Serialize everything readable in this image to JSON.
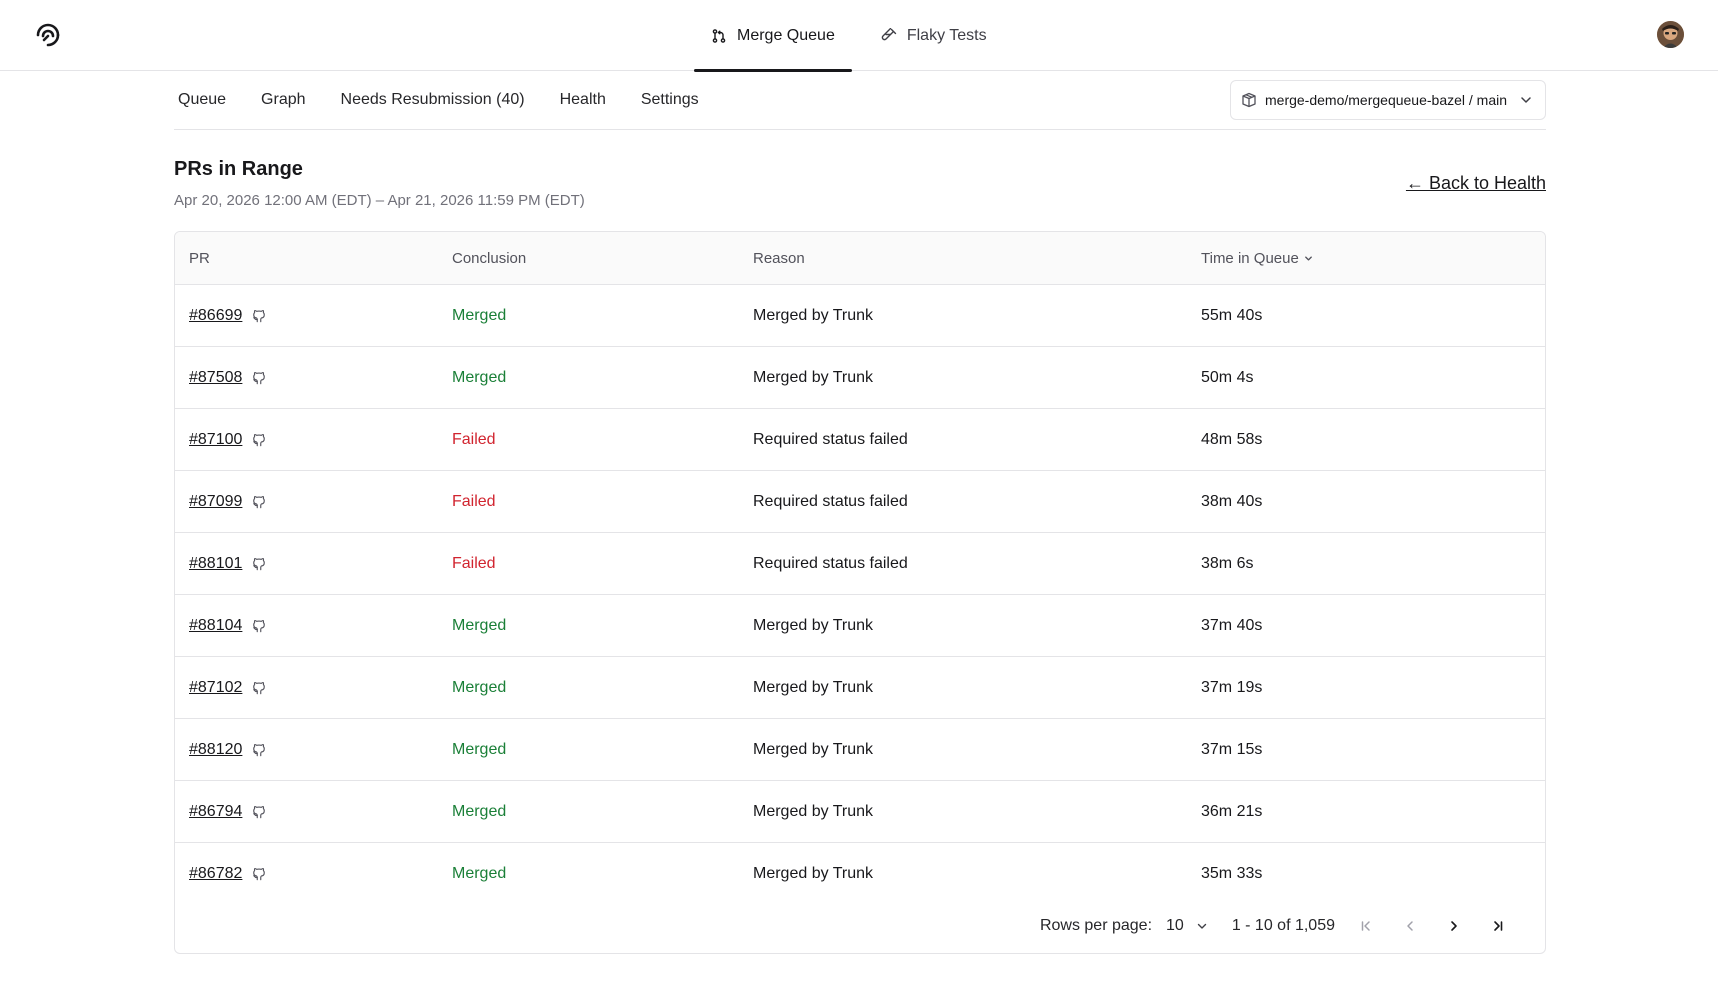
{
  "topnav": {
    "tabs": [
      {
        "label": "Merge Queue",
        "icon": "merge-icon",
        "active": true
      },
      {
        "label": "Flaky Tests",
        "icon": "test-tube-icon",
        "active": false
      }
    ]
  },
  "subnav": {
    "tabs": [
      "Queue",
      "Graph",
      "Needs Resubmission (40)",
      "Health",
      "Settings"
    ],
    "repo_selector": "merge-demo/mergequeue-bazel / main"
  },
  "page": {
    "title": "PRs in Range",
    "subtitle": "Apr 20, 2026 12:00 AM (EDT) – Apr 21, 2026 11:59 PM (EDT)",
    "back_link": "← Back to Health"
  },
  "table": {
    "columns": [
      "PR",
      "Conclusion",
      "Reason",
      "Time in Queue"
    ],
    "rows": [
      {
        "pr": "#86699",
        "conclusion": "Merged",
        "status": "merged",
        "reason": "Merged by Trunk",
        "time": "55m 40s"
      },
      {
        "pr": "#87508",
        "conclusion": "Merged",
        "status": "merged",
        "reason": "Merged by Trunk",
        "time": "50m 4s"
      },
      {
        "pr": "#87100",
        "conclusion": "Failed",
        "status": "failed",
        "reason": "Required status failed",
        "time": "48m 58s"
      },
      {
        "pr": "#87099",
        "conclusion": "Failed",
        "status": "failed",
        "reason": "Required status failed",
        "time": "38m 40s"
      },
      {
        "pr": "#88101",
        "conclusion": "Failed",
        "status": "failed",
        "reason": "Required status failed",
        "time": "38m 6s"
      },
      {
        "pr": "#88104",
        "conclusion": "Merged",
        "status": "merged",
        "reason": "Merged by Trunk",
        "time": "37m 40s"
      },
      {
        "pr": "#87102",
        "conclusion": "Merged",
        "status": "merged",
        "reason": "Merged by Trunk",
        "time": "37m 19s"
      },
      {
        "pr": "#88120",
        "conclusion": "Merged",
        "status": "merged",
        "reason": "Merged by Trunk",
        "time": "37m 15s"
      },
      {
        "pr": "#86794",
        "conclusion": "Merged",
        "status": "merged",
        "reason": "Merged by Trunk",
        "time": "36m 21s"
      },
      {
        "pr": "#86782",
        "conclusion": "Merged",
        "status": "merged",
        "reason": "Merged by Trunk",
        "time": "35m 33s"
      }
    ]
  },
  "pagination": {
    "rows_per_page_label": "Rows per page:",
    "rows_per_page": "10",
    "range": "1 - 10 of 1,059"
  },
  "colors": {
    "merged": "#1a7f37",
    "failed": "#d1242f",
    "border": "#e4e4e7"
  }
}
